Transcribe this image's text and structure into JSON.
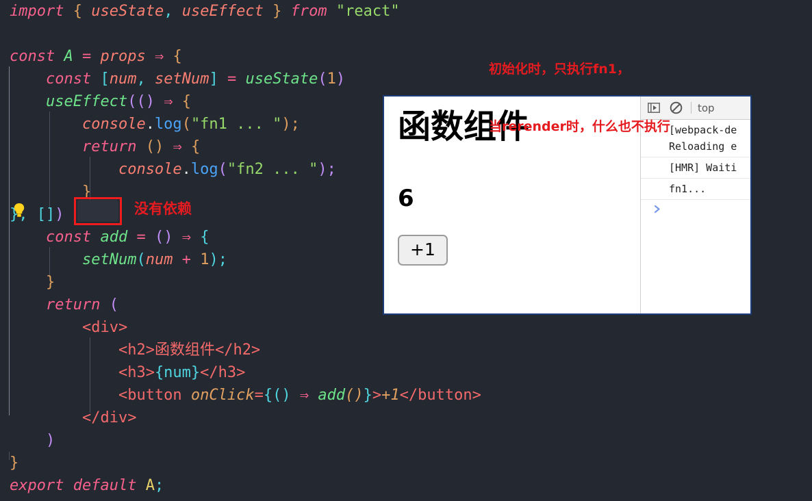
{
  "editor": {
    "background": "#242831",
    "lines": [
      [
        {
          "t": "import",
          "c": "kw"
        },
        {
          "t": " ",
          "c": "plain"
        },
        {
          "t": "{",
          "c": "punc"
        },
        {
          "t": " ",
          "c": "plain"
        },
        {
          "t": "useState",
          "c": "ident"
        },
        {
          "t": ",",
          "c": "cyan"
        },
        {
          "t": " ",
          "c": "plain"
        },
        {
          "t": "useEffect",
          "c": "ident"
        },
        {
          "t": " ",
          "c": "plain"
        },
        {
          "t": "}",
          "c": "punc"
        },
        {
          "t": " ",
          "c": "plain"
        },
        {
          "t": "from",
          "c": "kw"
        },
        {
          "t": " ",
          "c": "plain"
        },
        {
          "t": "\"react\"",
          "c": "str"
        }
      ],
      [],
      [
        {
          "t": "const",
          "c": "kw"
        },
        {
          "t": " ",
          "c": "plain"
        },
        {
          "t": "A",
          "c": "fn"
        },
        {
          "t": " ",
          "c": "plain"
        },
        {
          "t": "=",
          "c": "op"
        },
        {
          "t": " ",
          "c": "plain"
        },
        {
          "t": "props",
          "c": "ident"
        },
        {
          "t": " ",
          "c": "plain"
        },
        {
          "t": "⇒",
          "c": "op"
        },
        {
          "t": " ",
          "c": "plain"
        },
        {
          "t": "{",
          "c": "punc"
        }
      ],
      [
        {
          "t": "    ",
          "c": "plain"
        },
        {
          "t": "const",
          "c": "kw"
        },
        {
          "t": " ",
          "c": "plain"
        },
        {
          "t": "[",
          "c": "cyan"
        },
        {
          "t": "num",
          "c": "ident"
        },
        {
          "t": ",",
          "c": "cyan"
        },
        {
          "t": " ",
          "c": "plain"
        },
        {
          "t": "setNum",
          "c": "ident"
        },
        {
          "t": "]",
          "c": "cyan"
        },
        {
          "t": " ",
          "c": "plain"
        },
        {
          "t": "=",
          "c": "op"
        },
        {
          "t": " ",
          "c": "plain"
        },
        {
          "t": "useState",
          "c": "fn"
        },
        {
          "t": "(",
          "c": "purple"
        },
        {
          "t": "1",
          "c": "num"
        },
        {
          "t": ")",
          "c": "purple"
        }
      ],
      [
        {
          "t": "    ",
          "c": "plain"
        },
        {
          "t": "useEffect",
          "c": "fn"
        },
        {
          "t": "(",
          "c": "purple"
        },
        {
          "t": "(",
          "c": "purple"
        },
        {
          "t": ")",
          "c": "purple"
        },
        {
          "t": " ",
          "c": "plain"
        },
        {
          "t": "⇒",
          "c": "op"
        },
        {
          "t": " ",
          "c": "plain"
        },
        {
          "t": "{",
          "c": "punc"
        }
      ],
      [
        {
          "t": "        ",
          "c": "plain"
        },
        {
          "t": "console",
          "c": "ident"
        },
        {
          "t": ".",
          "c": "plain"
        },
        {
          "t": "log",
          "c": "blue"
        },
        {
          "t": "(",
          "c": "punc"
        },
        {
          "t": "\"fn1 ... \"",
          "c": "str"
        },
        {
          "t": ")",
          "c": "punc"
        },
        {
          "t": ";",
          "c": "punc"
        }
      ],
      [
        {
          "t": "        ",
          "c": "plain"
        },
        {
          "t": "return",
          "c": "kw"
        },
        {
          "t": " ",
          "c": "plain"
        },
        {
          "t": "(",
          "c": "punc"
        },
        {
          "t": ")",
          "c": "punc"
        },
        {
          "t": " ",
          "c": "plain"
        },
        {
          "t": "⇒",
          "c": "op"
        },
        {
          "t": " ",
          "c": "plain"
        },
        {
          "t": "{",
          "c": "punc"
        }
      ],
      [
        {
          "t": "            ",
          "c": "plain"
        },
        {
          "t": "console",
          "c": "ident"
        },
        {
          "t": ".",
          "c": "plain"
        },
        {
          "t": "log",
          "c": "blue"
        },
        {
          "t": "(",
          "c": "purple"
        },
        {
          "t": "\"fn2 ... \"",
          "c": "str"
        },
        {
          "t": ")",
          "c": "purple"
        },
        {
          "t": ";",
          "c": "purple"
        }
      ],
      [
        {
          "t": "        ",
          "c": "plain"
        },
        {
          "t": "}",
          "c": "punc"
        }
      ],
      [
        {
          "t": "}",
          "c": "cyan"
        },
        {
          "t": ",",
          "c": "cyan"
        },
        {
          "t": " ",
          "c": "plain"
        },
        {
          "t": "[",
          "c": "cyan"
        },
        {
          "t": "]",
          "c": "cyan"
        },
        {
          "t": ")",
          "c": "purple"
        }
      ],
      [
        {
          "t": "    ",
          "c": "plain"
        },
        {
          "t": "const",
          "c": "kw"
        },
        {
          "t": " ",
          "c": "plain"
        },
        {
          "t": "add",
          "c": "fn"
        },
        {
          "t": " ",
          "c": "plain"
        },
        {
          "t": "=",
          "c": "op"
        },
        {
          "t": " ",
          "c": "plain"
        },
        {
          "t": "(",
          "c": "purple"
        },
        {
          "t": ")",
          "c": "purple"
        },
        {
          "t": " ",
          "c": "plain"
        },
        {
          "t": "⇒",
          "c": "op"
        },
        {
          "t": " ",
          "c": "plain"
        },
        {
          "t": "{",
          "c": "cyan"
        }
      ],
      [
        {
          "t": "        ",
          "c": "plain"
        },
        {
          "t": "setNum",
          "c": "fn"
        },
        {
          "t": "(",
          "c": "cyan"
        },
        {
          "t": "num",
          "c": "ident"
        },
        {
          "t": " ",
          "c": "plain"
        },
        {
          "t": "+",
          "c": "op"
        },
        {
          "t": " ",
          "c": "plain"
        },
        {
          "t": "1",
          "c": "num"
        },
        {
          "t": ")",
          "c": "cyan"
        },
        {
          "t": ";",
          "c": "cyan"
        }
      ],
      [
        {
          "t": "    ",
          "c": "plain"
        },
        {
          "t": "}",
          "c": "punc"
        }
      ],
      [
        {
          "t": "    ",
          "c": "plain"
        },
        {
          "t": "return",
          "c": "kw"
        },
        {
          "t": " ",
          "c": "plain"
        },
        {
          "t": "(",
          "c": "purple"
        }
      ],
      [
        {
          "t": "        ",
          "c": "plain"
        },
        {
          "t": "<div>",
          "c": "tag"
        }
      ],
      [
        {
          "t": "            ",
          "c": "plain"
        },
        {
          "t": "<h2>",
          "c": "tag"
        },
        {
          "t": "函数组件",
          "c": "serif"
        },
        {
          "t": "</h2>",
          "c": "tag"
        }
      ],
      [
        {
          "t": "            ",
          "c": "plain"
        },
        {
          "t": "<h3>",
          "c": "tag"
        },
        {
          "t": "{num}",
          "c": "cyan"
        },
        {
          "t": "</h3>",
          "c": "tag"
        }
      ],
      [
        {
          "t": "            ",
          "c": "plain"
        },
        {
          "t": "<button",
          "c": "tag"
        },
        {
          "t": " ",
          "c": "plain"
        },
        {
          "t": "onClick",
          "c": "attr"
        },
        {
          "t": "=",
          "c": "tag"
        },
        {
          "t": "{",
          "c": "cyan"
        },
        {
          "t": "(",
          "c": "cyan"
        },
        {
          "t": ")",
          "c": "cyan"
        },
        {
          "t": " ",
          "c": "plain"
        },
        {
          "t": "⇒",
          "c": "op"
        },
        {
          "t": " ",
          "c": "plain"
        },
        {
          "t": "add",
          "c": "fn"
        },
        {
          "t": "(",
          "c": "attr"
        },
        {
          "t": ")",
          "c": "attr"
        },
        {
          "t": "}",
          "c": "cyan"
        },
        {
          "t": ">",
          "c": "tag"
        },
        {
          "t": "+1",
          "c": "attr"
        },
        {
          "t": "</button>",
          "c": "tag"
        }
      ],
      [
        {
          "t": "        ",
          "c": "plain"
        },
        {
          "t": "</div>",
          "c": "tag"
        }
      ],
      [
        {
          "t": "    ",
          "c": "plain"
        },
        {
          "t": ")",
          "c": "purple"
        }
      ],
      [
        {
          "t": "}",
          "c": "punc"
        }
      ],
      [
        {
          "t": "export",
          "c": "kw"
        },
        {
          "t": " ",
          "c": "plain"
        },
        {
          "t": "default",
          "c": "kw"
        },
        {
          "t": " ",
          "c": "plain"
        },
        {
          "t": "A",
          "c": "yellow"
        },
        {
          "t": ";",
          "c": "cyan"
        }
      ]
    ]
  },
  "annotations": {
    "dependency_note": "没有依赖",
    "top_note_line1": "初始化时，只执行fn1，",
    "top_note_line2": "当rerender时，什么也不执行",
    "color": "#e51b20",
    "bulb_icon": "lightbulb-icon"
  },
  "preview": {
    "heading": "函数组件",
    "count": "6",
    "button_label": "+1"
  },
  "devtools": {
    "toolbar": {
      "drawer_icon": "console-drawer-icon",
      "clear_icon": "clear-console-icon",
      "context": "top"
    },
    "logs": [
      "[webpack-de\nReloading e",
      "[HMR] Waiti",
      "fn1..."
    ],
    "prompt": "❯"
  }
}
